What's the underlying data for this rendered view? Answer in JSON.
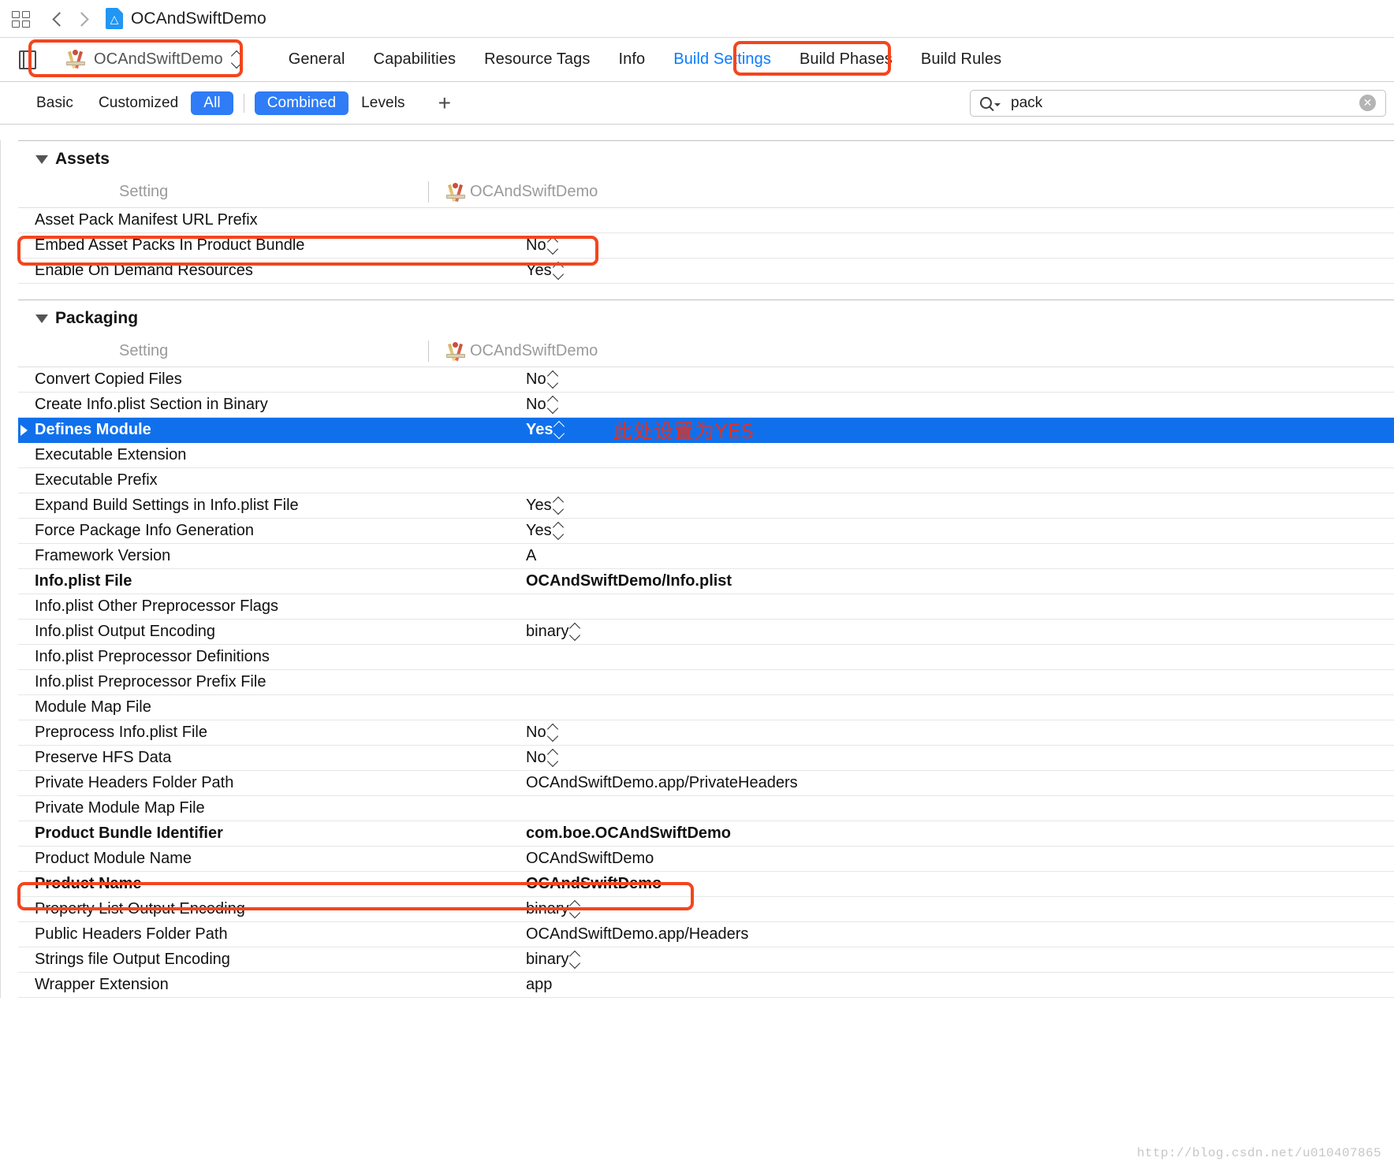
{
  "navbar": {
    "grid_icon": "grid-icon",
    "back_icon": "chevron-left-icon",
    "forward_icon": "chevron-right-icon",
    "file_icon": "project-file-icon",
    "title": "OCAndSwiftDemo"
  },
  "tabbar": {
    "pane_toggle_icon": "navigator-toggle-icon",
    "scheme_name": "OCAndSwiftDemo",
    "scheme_icon": "xcode-target-icon",
    "tabs": [
      {
        "label": "General",
        "active": false
      },
      {
        "label": "Capabilities",
        "active": false
      },
      {
        "label": "Resource Tags",
        "active": false
      },
      {
        "label": "Info",
        "active": false
      },
      {
        "label": "Build Settings",
        "active": true
      },
      {
        "label": "Build Phases",
        "active": false
      },
      {
        "label": "Build Rules",
        "active": false
      }
    ]
  },
  "filterbar": {
    "buttons": [
      {
        "label": "Basic",
        "on": false
      },
      {
        "label": "Customized",
        "on": false
      },
      {
        "label": "All",
        "on": true
      },
      {
        "label": "Combined",
        "on": true
      },
      {
        "label": "Levels",
        "on": false
      }
    ],
    "add_label": "+",
    "search": {
      "value": "pack",
      "placeholder": "",
      "search_icon": "magnifier-icon",
      "clear_icon": "clear-circle-icon",
      "clear_glyph": "✕"
    }
  },
  "sections": [
    {
      "title": "Assets",
      "column_headers": {
        "setting": "Setting",
        "target": "OCAndSwiftDemo"
      },
      "rows": [
        {
          "name": "Asset Pack Manifest URL Prefix",
          "value": "",
          "stepper": false,
          "bold": false,
          "selected": false
        },
        {
          "name": "Embed Asset Packs In Product Bundle",
          "value": "No",
          "stepper": true,
          "bold": false,
          "selected": false
        },
        {
          "name": "Enable On Demand Resources",
          "value": "Yes",
          "stepper": true,
          "bold": false,
          "selected": false
        }
      ]
    },
    {
      "title": "Packaging",
      "column_headers": {
        "setting": "Setting",
        "target": "OCAndSwiftDemo"
      },
      "rows": [
        {
          "name": "Convert Copied Files",
          "value": "No",
          "stepper": true,
          "bold": false,
          "selected": false
        },
        {
          "name": "Create Info.plist Section in Binary",
          "value": "No",
          "stepper": true,
          "bold": false,
          "selected": false
        },
        {
          "name": "Defines Module",
          "value": "Yes",
          "stepper": true,
          "bold": true,
          "selected": true,
          "expandable": true
        },
        {
          "name": "Executable Extension",
          "value": "",
          "stepper": false,
          "bold": false,
          "selected": false
        },
        {
          "name": "Executable Prefix",
          "value": "",
          "stepper": false,
          "bold": false,
          "selected": false
        },
        {
          "name": "Expand Build Settings in Info.plist File",
          "value": "Yes",
          "stepper": true,
          "bold": false,
          "selected": false
        },
        {
          "name": "Force Package Info Generation",
          "value": "Yes",
          "stepper": true,
          "bold": false,
          "selected": false
        },
        {
          "name": "Framework Version",
          "value": "A",
          "stepper": false,
          "bold": false,
          "selected": false
        },
        {
          "name": "Info.plist File",
          "value": "OCAndSwiftDemo/Info.plist",
          "stepper": false,
          "bold": true,
          "selected": false
        },
        {
          "name": "Info.plist Other Preprocessor Flags",
          "value": "",
          "stepper": false,
          "bold": false,
          "selected": false
        },
        {
          "name": "Info.plist Output Encoding",
          "value": "binary",
          "stepper": true,
          "bold": false,
          "selected": false
        },
        {
          "name": "Info.plist Preprocessor Definitions",
          "value": "",
          "stepper": false,
          "bold": false,
          "selected": false
        },
        {
          "name": "Info.plist Preprocessor Prefix File",
          "value": "",
          "stepper": false,
          "bold": false,
          "selected": false
        },
        {
          "name": "Module Map File",
          "value": "",
          "stepper": false,
          "bold": false,
          "selected": false
        },
        {
          "name": "Preprocess Info.plist File",
          "value": "No",
          "stepper": true,
          "bold": false,
          "selected": false
        },
        {
          "name": "Preserve HFS Data",
          "value": "No",
          "stepper": true,
          "bold": false,
          "selected": false
        },
        {
          "name": "Private Headers Folder Path",
          "value": "OCAndSwiftDemo.app/PrivateHeaders",
          "stepper": false,
          "bold": false,
          "selected": false
        },
        {
          "name": "Private Module Map File",
          "value": "",
          "stepper": false,
          "bold": false,
          "selected": false
        },
        {
          "name": "Product Bundle Identifier",
          "value": "com.boe.OCAndSwiftDemo",
          "stepper": false,
          "bold": true,
          "selected": false
        },
        {
          "name": "Product Module Name",
          "value": "OCAndSwiftDemo",
          "stepper": false,
          "bold": false,
          "selected": false
        },
        {
          "name": "Product Name",
          "value": "OCAndSwiftDemo",
          "stepper": false,
          "bold": true,
          "selected": false
        },
        {
          "name": "Property List Output Encoding",
          "value": "binary",
          "stepper": true,
          "bold": false,
          "selected": false
        },
        {
          "name": "Public Headers Folder Path",
          "value": "OCAndSwiftDemo.app/Headers",
          "stepper": false,
          "bold": false,
          "selected": false
        },
        {
          "name": "Strings file Output Encoding",
          "value": "binary",
          "stepper": true,
          "bold": false,
          "selected": false
        },
        {
          "name": "Wrapper Extension",
          "value": "app",
          "stepper": false,
          "bold": false,
          "selected": false
        }
      ]
    }
  ],
  "annotations": {
    "chinese_note": "此处设置为YES",
    "highlight_color": "#f4451e"
  },
  "watermark": "http://blog.csdn.net/u010407865"
}
